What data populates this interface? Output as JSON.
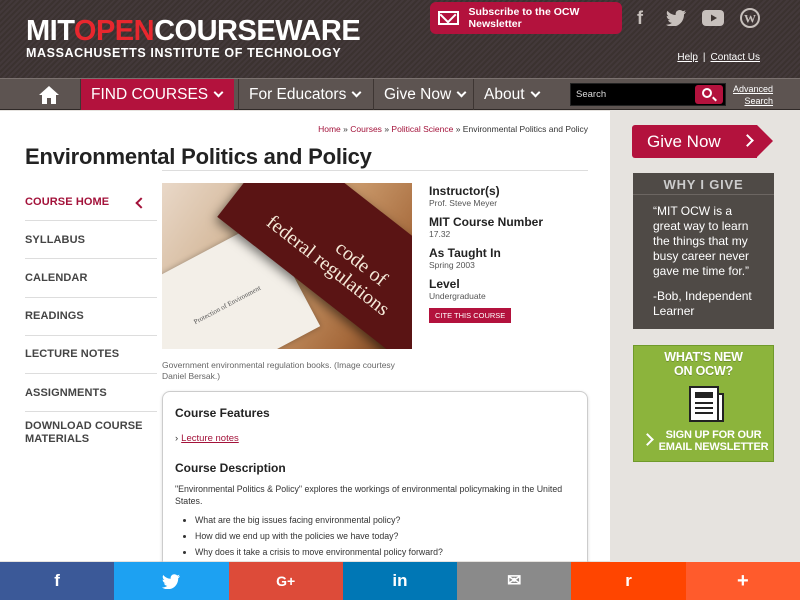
{
  "header": {
    "logo_mit": "MIT",
    "logo_open": "OPEN",
    "logo_courseware": "COURSEWARE",
    "logo_sub": "MASSACHUSETTS INSTITUTE OF TECHNOLOGY",
    "newsletter_label": "Subscribe to the OCW Newsletter",
    "social": {
      "facebook": "f",
      "twitter": "t",
      "youtube": "▶",
      "wordpress": "W"
    },
    "help": "Help",
    "separator": "|",
    "contact": "Contact Us"
  },
  "nav": {
    "find_courses": "FIND COURSES",
    "educators": "For Educators",
    "give_now": "Give Now",
    "about": "About",
    "search_placeholder": "Search",
    "advanced_line1": "Advanced",
    "advanced_line2": "Search"
  },
  "breadcrumb": {
    "home": "Home",
    "courses": "Courses",
    "dept": "Political Science",
    "sep": "»",
    "current": "Environmental Politics and Policy"
  },
  "page_title": "Environmental Politics and Policy",
  "leftnav": {
    "items": [
      {
        "label": "COURSE HOME"
      },
      {
        "label": "SYLLABUS"
      },
      {
        "label": "CALENDAR"
      },
      {
        "label": "READINGS"
      },
      {
        "label": "LECTURE NOTES"
      },
      {
        "label": "ASSIGNMENTS"
      },
      {
        "label_line1": "DOWNLOAD COURSE",
        "label_line2": "MATERIALS"
      }
    ]
  },
  "hero": {
    "book_text_line1": "code of",
    "book_text_line2": "federal regulations",
    "small_text": "Protection of Environment",
    "caption": "Government environmental regulation books. (Image courtesy Daniel Bersak.)"
  },
  "info": {
    "instructor_label": "Instructor(s)",
    "instructor_value": "Prof. Steve Meyer",
    "number_label": "MIT Course Number",
    "number_value": "17.32",
    "taught_label": "As Taught In",
    "taught_value": "Spring 2003",
    "level_label": "Level",
    "level_value": "Undergraduate",
    "cite_button": "CITE THIS COURSE"
  },
  "features": {
    "heading": "Course Features",
    "link": "Lecture notes",
    "desc_heading": "Course Description",
    "desc_text": "\"Environmental Politics & Policy\" explores the workings of environmental policymaking in the United States.",
    "bullets": [
      "What are the big issues facing environmental policy?",
      "How did we end up with the policies we have today?",
      "Why does it take a crisis to move environmental policy forward?"
    ]
  },
  "sidebar": {
    "give_now": "Give Now",
    "why_heading": "WHY I GIVE",
    "why_quote": "“MIT OCW is a great way to learn the things that my busy career never gave me time for.”",
    "why_author": "-Bob, Independent Learner",
    "whatsnew_line1": "WHAT'S NEW",
    "whatsnew_line2": "ON OCW?",
    "signup_line1": "SIGN UP FOR OUR",
    "signup_line2": "EMAIL NEWSLETTER"
  },
  "share": {
    "facebook": "f",
    "twitter": "t",
    "googleplus": "G+",
    "linkedin": "in",
    "email": "✉",
    "reddit": "r",
    "more": "+"
  },
  "colors": {
    "brand_red": "#b3123d",
    "facebook": "#3b5998",
    "twitter": "#1da1f2",
    "googleplus": "#dd4b39",
    "linkedin": "#0077b5",
    "email": "#8a8a8a",
    "reddit": "#ff4500",
    "more": "#ff5b2c",
    "whatsnew_green": "#8cb43c"
  }
}
